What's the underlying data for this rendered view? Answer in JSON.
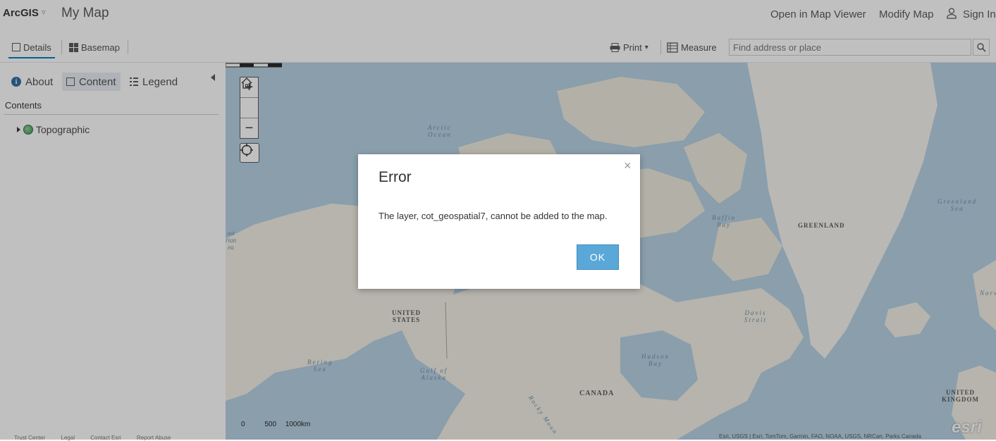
{
  "header": {
    "brand": "ArcGIS",
    "brand_caret": "▿",
    "map_title": "My Map",
    "links": {
      "open_in_map_viewer": "Open in Map Viewer",
      "modify_map": "Modify Map",
      "sign_in": "Sign In"
    }
  },
  "toolbar": {
    "details": "Details",
    "basemap": "Basemap",
    "print": "Print",
    "print_caret": "▾",
    "measure": "Measure",
    "search_placeholder": "Find address or place"
  },
  "sidepanel": {
    "tabs": {
      "about": "About",
      "content": "Content",
      "legend": "Legend"
    },
    "contents_header": "Contents",
    "layers": [
      {
        "label": "Topographic"
      }
    ],
    "footer_links": [
      "Trust Center",
      "Legal",
      "Contact Esri",
      "Report Abuse"
    ]
  },
  "map": {
    "zoom_in": "+",
    "zoom_out": "−",
    "labels": {
      "arctic_ocean_1": "Arctic",
      "arctic_ocean_2": "Ocean",
      "baffin_bay_1": "Baffin",
      "baffin_bay_2": "Bay",
      "greenland": "GREENLAND",
      "greenland_sea_1": "Greenland",
      "greenland_sea_2": "Sea",
      "united_states_1": "UNITED",
      "united_states_2": "STATES",
      "davis_strait_1": "Davis",
      "davis_strait_2": "Strait",
      "bering_sea_1": "Bering",
      "bering_sea_2": "Sea",
      "gulf_of_alaska_1": "Gulf of",
      "gulf_of_alaska_2": "Alaska",
      "hudson_bay_1": "Hudson",
      "hudson_bay_2": "Bay",
      "canada": "CANADA",
      "rocky_mountains": "Rocky Moun",
      "united_kingdom_1": "UNITED",
      "united_kingdom_2": "KINGDOM",
      "norwegian_sea": "Norw",
      "east_siberian_1": "ast",
      "east_siberian_2": "rian",
      "east_siberian_3": "ea"
    },
    "scale": {
      "zero": "0",
      "mid": "500",
      "end": "1000km"
    },
    "attribution": "Esri, USGS | Esri, TomTom, Garmin, FAO, NOAA, USGS, NRCan, Parks Canada",
    "logo": "esri"
  },
  "dialog": {
    "title": "Error",
    "close": "×",
    "message": "The layer, cot_geospatial7, cannot be added to the map.",
    "ok": "OK"
  },
  "colors": {
    "accent": "#0079c1",
    "ok_button": "#5aa8d8",
    "water": "#b5d0e3",
    "land": "#f1efe4"
  }
}
